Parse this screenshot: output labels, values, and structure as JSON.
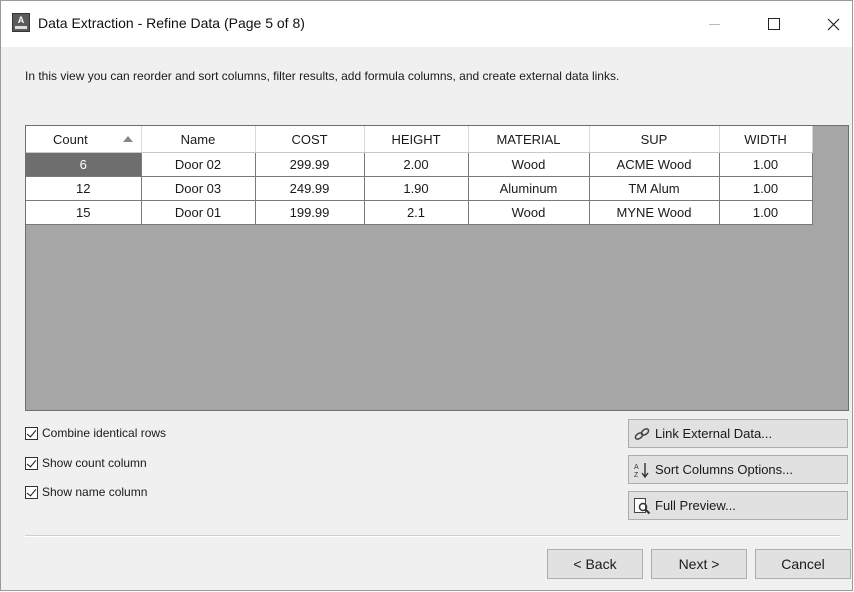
{
  "window": {
    "title": "Data Extraction - Refine Data (Page 5 of 8)",
    "app_icon_letter": "A"
  },
  "description": "In this view you can reorder and sort columns, filter results, add formula columns, and create external data links.",
  "grid": {
    "columns": [
      "Count",
      "Name",
      "COST",
      "HEIGHT",
      "MATERIAL",
      "SUP",
      "WIDTH"
    ],
    "sorted_column": "Count",
    "sort_direction": "ascending",
    "rows": [
      [
        "6",
        "Door 02",
        "299.99",
        "2.00",
        "Wood",
        "ACME Wood",
        "1.00"
      ],
      [
        "12",
        "Door 03",
        "249.99",
        "1.90",
        "Aluminum",
        "TM Alum",
        "1.00"
      ],
      [
        "15",
        "Door 01",
        "199.99",
        "2.1",
        "Wood",
        "MYNE Wood",
        "1.00"
      ]
    ],
    "selected_row": 0
  },
  "options": {
    "combine_label": "Combine identical rows",
    "combine_checked": true,
    "count_label": "Show count column",
    "count_checked": true,
    "name_label": "Show name column",
    "name_checked": true
  },
  "side_buttons": {
    "link_label": "Link External Data...",
    "sort_label": "Sort Columns Options...",
    "preview_label": "Full Preview..."
  },
  "nav": {
    "back_label": "< Back",
    "next_label": "Next >",
    "cancel_label": "Cancel"
  },
  "icons": {
    "app": "autocad-icon",
    "link": "link-icon",
    "sort": "sort-az-icon",
    "preview": "magnifier-preview-icon"
  }
}
